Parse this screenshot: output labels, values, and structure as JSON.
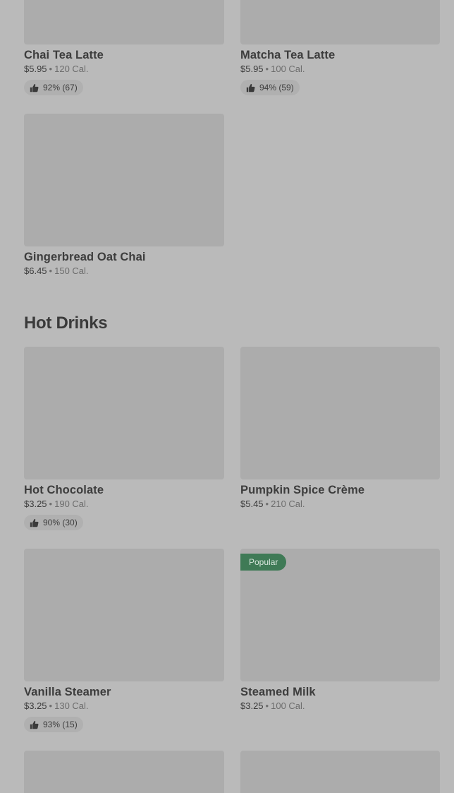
{
  "sections": {
    "hot_drinks_title": "Hot Drinks"
  },
  "cards": [
    {
      "name": "Chai Tea Latte",
      "price": "$5.95",
      "separator": "•",
      "calories": "120 Cal.",
      "rating": "92% (67)"
    },
    {
      "name": "Matcha Tea Latte",
      "price": "$5.95",
      "separator": "•",
      "calories": "100 Cal.",
      "rating": "94% (59)"
    },
    {
      "name": "Gingerbread Oat Chai",
      "price": "$6.45",
      "separator": "•",
      "calories": "150 Cal."
    },
    {
      "name": "Hot Chocolate",
      "price": "$3.25",
      "separator": "•",
      "calories": "190 Cal.",
      "rating": "90% (30)"
    },
    {
      "name": "Pumpkin Spice Crème",
      "price": "$5.45",
      "separator": "•",
      "calories": "210 Cal."
    },
    {
      "name": "Vanilla Steamer",
      "price": "$3.25",
      "separator": "•",
      "calories": "130 Cal.",
      "rating": "93% (15)"
    },
    {
      "name": "Steamed Milk",
      "price": "$3.25",
      "separator": "•",
      "calories": "100 Cal.",
      "badge": "Popular"
    }
  ],
  "icons": {
    "rating": "thumbs-up-icon"
  },
  "colors": {
    "background": "#bababa",
    "thumbnail": "#acacac",
    "badge": "#3f7a56"
  }
}
